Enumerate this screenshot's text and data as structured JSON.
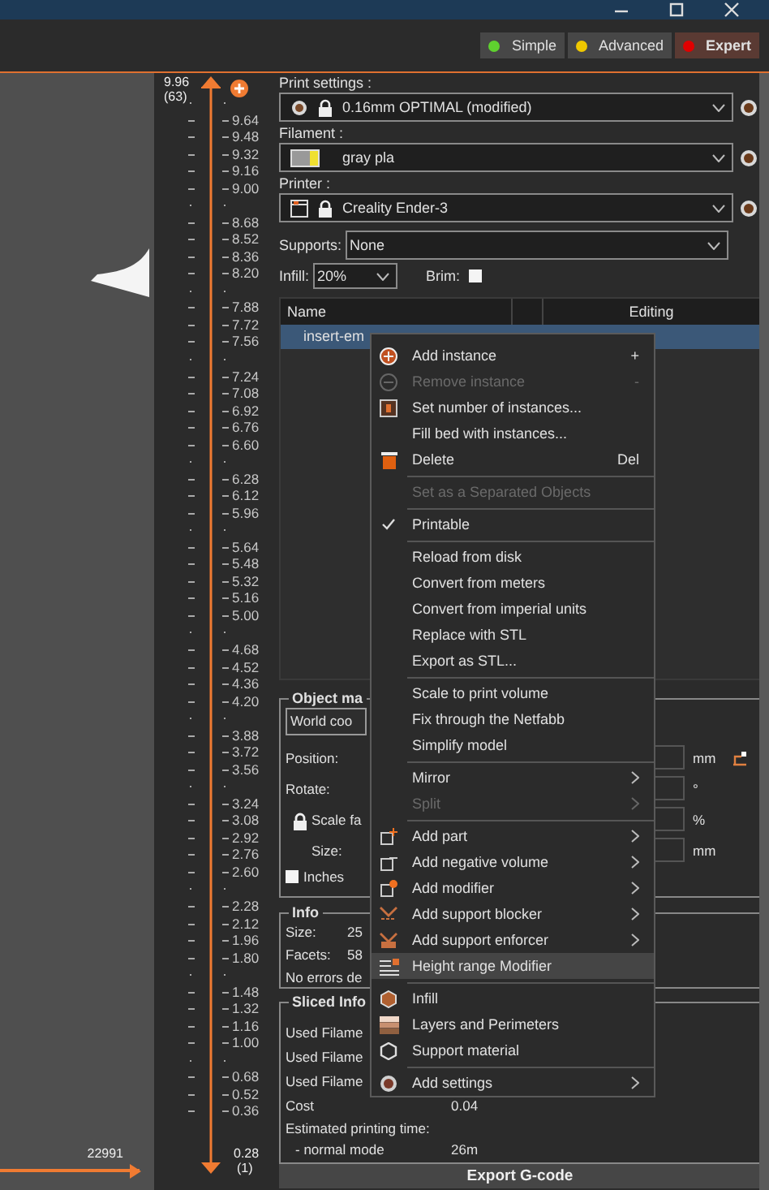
{
  "modes": [
    {
      "label": "Simple",
      "color": "#5fd12f",
      "selected": false
    },
    {
      "label": "Advanced",
      "color": "#f0c800",
      "selected": false
    },
    {
      "label": "Expert",
      "color": "#e00000",
      "selected": true
    }
  ],
  "layer_slider": {
    "level": 1,
    "top_value": "9.96",
    "top_layer": "(63)",
    "bottom_value": "0.28",
    "bottom_layer": "(1)",
    "ticks": [
      {
        "kind": "minor"
      },
      {
        "kind": "major",
        "label": "9.64"
      },
      {
        "kind": "major",
        "label": "9.48"
      },
      {
        "kind": "major",
        "label": "9.32"
      },
      {
        "kind": "major",
        "label": "9.16"
      },
      {
        "kind": "major",
        "label": "9.00"
      },
      {
        "kind": "minor"
      },
      {
        "kind": "major",
        "label": "8.68"
      },
      {
        "kind": "major",
        "label": "8.52"
      },
      {
        "kind": "major",
        "label": "8.36"
      },
      {
        "kind": "major",
        "label": "8.20"
      },
      {
        "kind": "minor"
      },
      {
        "kind": "major",
        "label": "7.88"
      },
      {
        "kind": "major",
        "label": "7.72"
      },
      {
        "kind": "major",
        "label": "7.56"
      },
      {
        "kind": "minor"
      },
      {
        "kind": "major",
        "label": "7.24"
      },
      {
        "kind": "major",
        "label": "7.08"
      },
      {
        "kind": "major",
        "label": "6.92"
      },
      {
        "kind": "major",
        "label": "6.76"
      },
      {
        "kind": "major",
        "label": "6.60"
      },
      {
        "kind": "minor"
      },
      {
        "kind": "major",
        "label": "6.28"
      },
      {
        "kind": "major",
        "label": "6.12"
      },
      {
        "kind": "major",
        "label": "5.96"
      },
      {
        "kind": "minor"
      },
      {
        "kind": "major",
        "label": "5.64"
      },
      {
        "kind": "major",
        "label": "5.48"
      },
      {
        "kind": "major",
        "label": "5.32"
      },
      {
        "kind": "major",
        "label": "5.16"
      },
      {
        "kind": "major",
        "label": "5.00"
      },
      {
        "kind": "minor"
      },
      {
        "kind": "major",
        "label": "4.68"
      },
      {
        "kind": "major",
        "label": "4.52"
      },
      {
        "kind": "major",
        "label": "4.36"
      },
      {
        "kind": "major",
        "label": "4.20"
      },
      {
        "kind": "minor"
      },
      {
        "kind": "major",
        "label": "3.88"
      },
      {
        "kind": "major",
        "label": "3.72"
      },
      {
        "kind": "major",
        "label": "3.56"
      },
      {
        "kind": "minor"
      },
      {
        "kind": "major",
        "label": "3.24"
      },
      {
        "kind": "major",
        "label": "3.08"
      },
      {
        "kind": "major",
        "label": "2.92"
      },
      {
        "kind": "major",
        "label": "2.76"
      },
      {
        "kind": "major",
        "label": "2.60"
      },
      {
        "kind": "minor"
      },
      {
        "kind": "major",
        "label": "2.28"
      },
      {
        "kind": "major",
        "label": "2.12"
      },
      {
        "kind": "major",
        "label": "1.96"
      },
      {
        "kind": "major",
        "label": "1.80"
      },
      {
        "kind": "minor"
      },
      {
        "kind": "major",
        "label": "1.48"
      },
      {
        "kind": "major",
        "label": "1.32"
      },
      {
        "kind": "major",
        "label": "1.16"
      },
      {
        "kind": "major",
        "label": "1.00"
      },
      {
        "kind": "minor"
      },
      {
        "kind": "major",
        "label": "0.68"
      },
      {
        "kind": "major",
        "label": "0.52"
      },
      {
        "kind": "major",
        "label": "0.36"
      }
    ]
  },
  "horizontal_slider": {
    "level": 1,
    "value": "22991"
  },
  "print_settings": {
    "label": "Print settings :",
    "value": "0.16mm OPTIMAL (modified)"
  },
  "filament": {
    "label": "Filament :",
    "value": "gray pla"
  },
  "printer": {
    "label": "Printer :",
    "value": "Creality Ender-3"
  },
  "supports": {
    "label": "Supports:",
    "value": "None"
  },
  "infill": {
    "label": "Infill:",
    "value": "20%"
  },
  "brim": {
    "label": "Brim:",
    "checked": false
  },
  "object_list": {
    "columns": [
      "Name",
      "Editing"
    ],
    "rows": [
      {
        "name": "insert-em",
        "selected": true
      }
    ]
  },
  "object_manipulation": {
    "title": "Object ma",
    "coordinates": "World coo",
    "rows": [
      {
        "label": "Position:",
        "unit": "mm"
      },
      {
        "label": "Rotate:",
        "unit": "°"
      },
      {
        "label": "Scale fa",
        "unit": "%"
      },
      {
        "label": "Size:",
        "unit": "mm"
      }
    ],
    "inches": {
      "label": "Inches",
      "checked": false
    }
  },
  "info": {
    "title": "Info",
    "rows": [
      {
        "label": "Size:",
        "value": "25"
      },
      {
        "label": "Facets:",
        "value": "58"
      }
    ],
    "status": "No errors de"
  },
  "sliced_info": {
    "title": "Sliced Info",
    "rows": [
      {
        "label": "Used Filame"
      },
      {
        "label": "Used Filame"
      },
      {
        "label": "Used Filame"
      },
      {
        "label": "Cost",
        "value": "0.04"
      }
    ],
    "time_label": "Estimated printing time:",
    "mode_label": "- normal mode",
    "mode_value": "26m"
  },
  "export_button": "Export G-code",
  "context_menu": {
    "items": [
      {
        "kind": "item",
        "label": "Add instance",
        "shortcut": "+",
        "disabled": false,
        "submenu": false,
        "highlighted": false
      },
      {
        "kind": "item",
        "label": "Remove instance",
        "shortcut": "-",
        "disabled": true,
        "submenu": false,
        "highlighted": false
      },
      {
        "kind": "item",
        "label": "Set number of instances...",
        "disabled": false,
        "submenu": false,
        "highlighted": false
      },
      {
        "kind": "item",
        "label": "Fill bed with instances...",
        "disabled": false,
        "submenu": false,
        "highlighted": false
      },
      {
        "kind": "item",
        "label": "Delete",
        "shortcut": "Del",
        "disabled": false,
        "submenu": false,
        "highlighted": false
      },
      {
        "kind": "separator"
      },
      {
        "kind": "item",
        "label": "Set as a Separated Objects",
        "disabled": true,
        "submenu": false,
        "highlighted": false
      },
      {
        "kind": "separator"
      },
      {
        "kind": "check",
        "label": "Printable",
        "checked": true,
        "disabled": false,
        "submenu": false,
        "highlighted": false
      },
      {
        "kind": "separator"
      },
      {
        "kind": "item",
        "label": "Reload from disk",
        "disabled": false,
        "submenu": false,
        "highlighted": false
      },
      {
        "kind": "item",
        "label": "Convert from meters",
        "disabled": false,
        "submenu": false,
        "highlighted": false
      },
      {
        "kind": "item",
        "label": "Convert from imperial units",
        "disabled": false,
        "submenu": false,
        "highlighted": false
      },
      {
        "kind": "item",
        "label": "Replace with STL",
        "disabled": false,
        "submenu": false,
        "highlighted": false
      },
      {
        "kind": "item",
        "label": "Export as STL...",
        "disabled": false,
        "submenu": false,
        "highlighted": false
      },
      {
        "kind": "separator"
      },
      {
        "kind": "item",
        "label": "Scale to print volume",
        "disabled": false,
        "submenu": false,
        "highlighted": false
      },
      {
        "kind": "item",
        "label": "Fix through the Netfabb",
        "disabled": false,
        "submenu": false,
        "highlighted": false
      },
      {
        "kind": "item",
        "label": "Simplify model",
        "disabled": false,
        "submenu": false,
        "highlighted": false
      },
      {
        "kind": "separator"
      },
      {
        "kind": "item",
        "label": "Mirror",
        "disabled": false,
        "submenu": true,
        "highlighted": false
      },
      {
        "kind": "item",
        "label": "Split",
        "disabled": true,
        "submenu": true,
        "highlighted": false
      },
      {
        "kind": "separator"
      },
      {
        "kind": "item",
        "label": "Add part",
        "disabled": false,
        "submenu": true,
        "highlighted": false
      },
      {
        "kind": "item",
        "label": "Add negative volume",
        "disabled": false,
        "submenu": true,
        "highlighted": false
      },
      {
        "kind": "item",
        "label": "Add modifier",
        "disabled": false,
        "submenu": true,
        "highlighted": false
      },
      {
        "kind": "item",
        "label": "Add support blocker",
        "disabled": false,
        "submenu": true,
        "highlighted": false
      },
      {
        "kind": "item",
        "label": "Add support enforcer",
        "disabled": false,
        "submenu": true,
        "highlighted": false
      },
      {
        "kind": "item",
        "label": "Height range Modifier",
        "disabled": false,
        "submenu": false,
        "highlighted": true
      },
      {
        "kind": "separator"
      },
      {
        "kind": "item",
        "label": "Infill",
        "disabled": false,
        "submenu": false,
        "highlighted": false
      },
      {
        "kind": "item",
        "label": "Layers and Perimeters",
        "disabled": false,
        "submenu": false,
        "highlighted": false
      },
      {
        "kind": "item",
        "label": "Support material",
        "disabled": false,
        "submenu": false,
        "highlighted": false
      },
      {
        "kind": "separator"
      },
      {
        "kind": "item",
        "label": "Add settings",
        "disabled": false,
        "submenu": true,
        "highlighted": false
      }
    ]
  }
}
